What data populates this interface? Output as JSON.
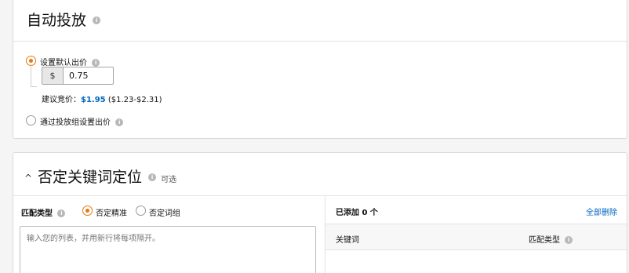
{
  "auto_section": {
    "title": "自动投放",
    "default_bid": {
      "label": "设置默认出价",
      "selected": true,
      "currency": "$",
      "value": "0.75",
      "suggested_label": "建议竞价：",
      "suggested_value": "$1.95",
      "suggested_range": "($1.23-$2.31)"
    },
    "group_bid": {
      "label": "通过投放组设置出价",
      "selected": false
    }
  },
  "negative_section": {
    "chevron": "^",
    "title": "否定关键词定位",
    "optional_label": "可选",
    "match_type_label": "匹配类型",
    "options": [
      {
        "label": "否定精准",
        "selected": true
      },
      {
        "label": "否定词组",
        "selected": false
      }
    ],
    "textarea_placeholder": "输入您的列表，并用新行将每项隔开。",
    "added_label": "已添加 0 个",
    "delete_all_label": "全部删除",
    "columns": [
      "关键词",
      "匹配类型"
    ]
  },
  "icons": {
    "info": "i",
    "radio": "radio-icon",
    "chevron": "chevron-up-icon"
  },
  "colors": {
    "accent": "#e47911",
    "link": "#0066c0",
    "border": "#d9d9d9"
  }
}
